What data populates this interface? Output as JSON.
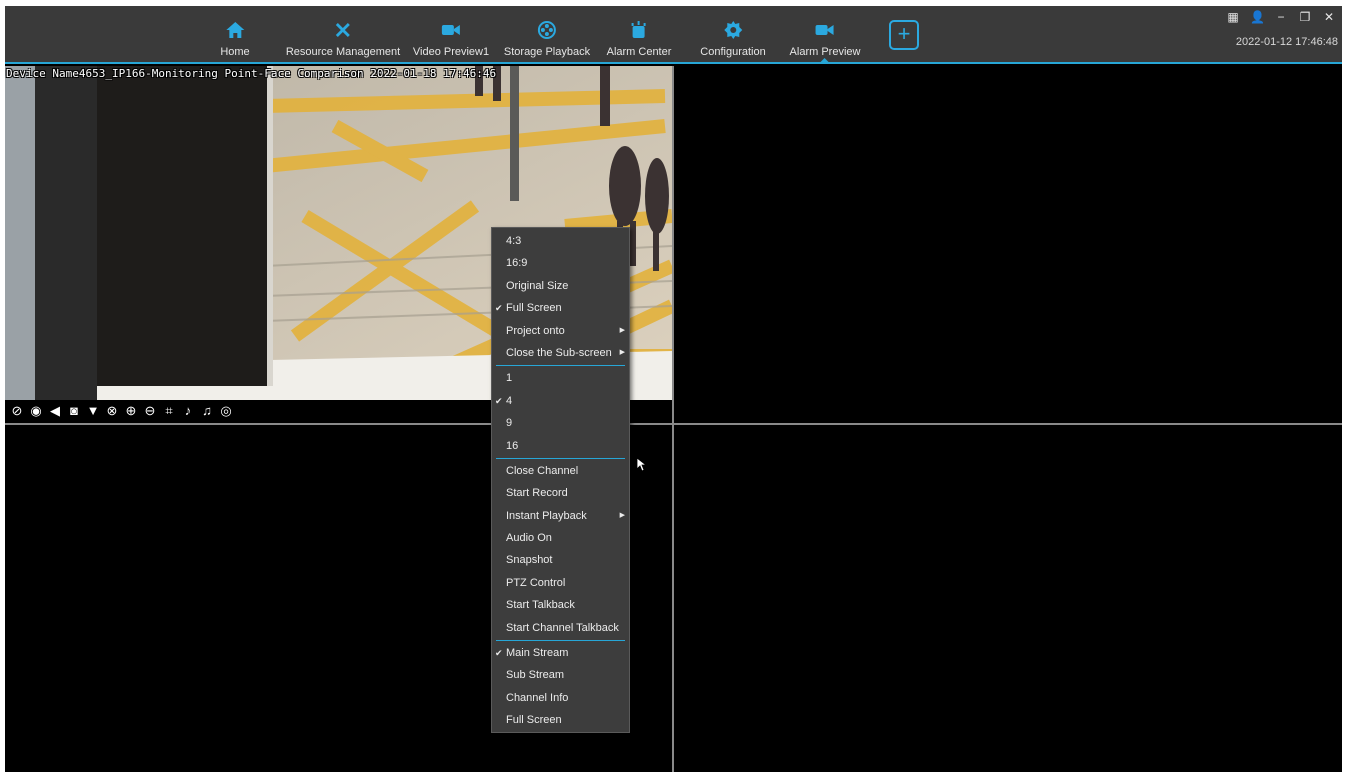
{
  "nav": {
    "items": [
      {
        "label": "Home",
        "icon": "home-icon"
      },
      {
        "label": "Resource Management",
        "icon": "tools-icon"
      },
      {
        "label": "Video Preview1",
        "icon": "camera-icon"
      },
      {
        "label": "Storage Playback",
        "icon": "film-reel-icon"
      },
      {
        "label": "Alarm Center",
        "icon": "alarm-icon"
      },
      {
        "label": "Configuration",
        "icon": "gear-icon"
      },
      {
        "label": "Alarm Preview",
        "icon": "camera-icon"
      }
    ],
    "active": "Alarm Preview",
    "add_label": "+"
  },
  "window": {
    "controls": [
      "▦",
      "👤",
      "−",
      "❐",
      "✕"
    ],
    "clock": "2022-01-12 17:46:48"
  },
  "video": {
    "osd": "Device Name4653_IP166-Monitoring Point-Face Comparison 2022-01-18 17:46:46",
    "toolbar_icons": [
      "hide-icon",
      "record-icon",
      "mute-icon",
      "snapshot-icon",
      "ptz-icon",
      "zoom-off-icon",
      "zoom-in-icon",
      "zoom-out-icon",
      "fit-icon",
      "mic-icon",
      "talk-icon",
      "location-icon"
    ]
  },
  "context_menu": {
    "groups": [
      [
        {
          "label": "4:3",
          "checked": false,
          "submenu": false
        },
        {
          "label": "16:9",
          "checked": false,
          "submenu": false
        },
        {
          "label": "Original Size",
          "checked": false,
          "submenu": false
        },
        {
          "label": "Full Screen",
          "checked": true,
          "submenu": false
        },
        {
          "label": "Project onto",
          "checked": false,
          "submenu": true
        },
        {
          "label": "Close the Sub-screen",
          "checked": false,
          "submenu": true
        }
      ],
      [
        {
          "label": "1",
          "checked": false,
          "submenu": false
        },
        {
          "label": "4",
          "checked": true,
          "submenu": false
        },
        {
          "label": "9",
          "checked": false,
          "submenu": false
        },
        {
          "label": "16",
          "checked": false,
          "submenu": false
        }
      ],
      [
        {
          "label": "Close Channel",
          "checked": false,
          "submenu": false
        },
        {
          "label": "Start Record",
          "checked": false,
          "submenu": false
        },
        {
          "label": "Instant Playback",
          "checked": false,
          "submenu": true
        },
        {
          "label": "Audio On",
          "checked": false,
          "submenu": false
        },
        {
          "label": "Snapshot",
          "checked": false,
          "submenu": false
        },
        {
          "label": "PTZ Control",
          "checked": false,
          "submenu": false
        },
        {
          "label": "Start Talkback",
          "checked": false,
          "submenu": false
        },
        {
          "label": "Start Channel Talkback",
          "checked": false,
          "submenu": false
        }
      ],
      [
        {
          "label": "Main Stream",
          "checked": true,
          "submenu": false
        },
        {
          "label": "Sub Stream",
          "checked": false,
          "submenu": false
        },
        {
          "label": "Channel Info",
          "checked": false,
          "submenu": false
        },
        {
          "label": "Full Screen",
          "checked": false,
          "submenu": false
        }
      ]
    ]
  },
  "colors": {
    "accent": "#2ba9e0",
    "topbar": "#3a3a3a",
    "menu_bg": "#3d3d3d"
  }
}
